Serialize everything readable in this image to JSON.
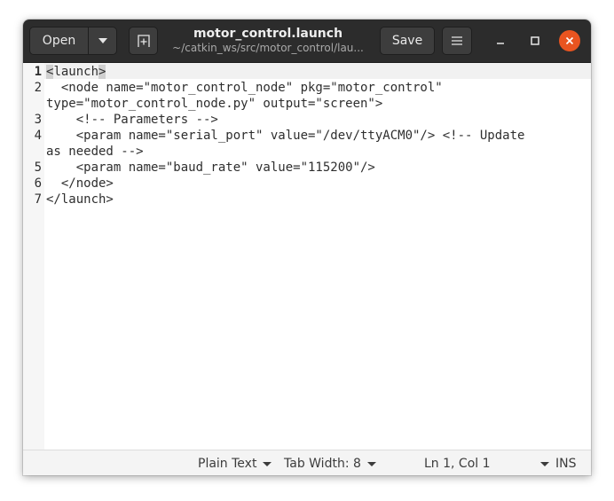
{
  "window": {
    "title": "motor_control.launch",
    "subtitle": "~/catkin_ws/src/motor_control/lau..."
  },
  "toolbar": {
    "open_label": "Open",
    "save_label": "Save"
  },
  "editor": {
    "lines": [
      {
        "number": "1",
        "rows": [
          "<launch>"
        ]
      },
      {
        "number": "2",
        "rows": [
          "  <node name=\"motor_control_node\" pkg=\"motor_control\"",
          "type=\"motor_control_node.py\" output=\"screen\">"
        ]
      },
      {
        "number": "3",
        "rows": [
          "    <!-- Parameters -->"
        ]
      },
      {
        "number": "4",
        "rows": [
          "    <param name=\"serial_port\" value=\"/dev/ttyACM0\"/> <!-- Update",
          "as needed -->"
        ]
      },
      {
        "number": "5",
        "rows": [
          "    <param name=\"baud_rate\" value=\"115200\"/>"
        ]
      },
      {
        "number": "6",
        "rows": [
          "  </node>"
        ]
      },
      {
        "number": "7",
        "rows": [
          "</launch>"
        ]
      }
    ]
  },
  "statusbar": {
    "language": "Plain Text",
    "tab_width": "Tab Width: 8",
    "position": "Ln 1, Col 1",
    "mode": "INS"
  }
}
